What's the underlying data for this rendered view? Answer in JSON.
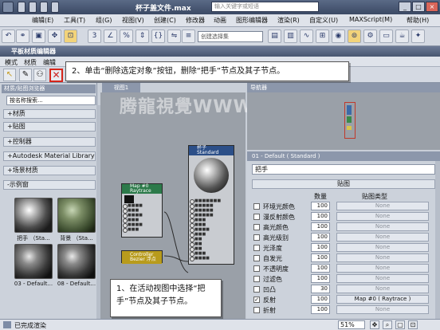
{
  "app": {
    "title": "杯子盖文件.max",
    "search_placeholder": "输入关键字或短语"
  },
  "menu": [
    "编辑(E)",
    "工具(T)",
    "组(G)",
    "视图(V)",
    "创建(C)",
    "修改器",
    "动画",
    "图形编辑器",
    "渲染(R)",
    "自定义(U)",
    "MAXScript(M)",
    "帮助(H)"
  ],
  "toolbar": {
    "selection_set": "创建选择集"
  },
  "slate": {
    "title": "平板材质编辑器",
    "menu": [
      "模式",
      "材质",
      "编辑"
    ],
    "view_tab": "视图1",
    "navigator_label": "导航器",
    "watermark": "腾龍視覺WWW.TL.NET"
  },
  "callouts": {
    "step2": "2、单击“删除选定对象”按钮，删除“把手”节点及其子节点。",
    "step1": "1、在活动视图中选择“把手”节点及其子节点。"
  },
  "browser": {
    "title": "材质/贴图浏览器",
    "search": "按名称搜索...",
    "categories": [
      "+材质",
      "+贴图",
      "+控制器",
      "+Autodesk Material Library",
      "+场景材质",
      "-示例窗"
    ],
    "samples": [
      {
        "label": "把手 （Sta..."
      },
      {
        "label": "背景 （Sta..."
      },
      {
        "label": "03 - Default..."
      },
      {
        "label": "08 - Default..."
      }
    ]
  },
  "nodes": {
    "cup_title": "杯子",
    "cup_sub": "Standard",
    "map_title": "Map #0",
    "map_sub": "Raytrace",
    "ctrl_title": "Controller",
    "ctrl_sub": "Bezier 浮点"
  },
  "params": {
    "header": "01 - Default ( Standard )",
    "material_name": "把手",
    "rollout": "贴图",
    "col_amount": "数量",
    "col_type": "贴图类型",
    "rows": [
      {
        "label": "环境光颜色",
        "amount": "100",
        "map": "None",
        "checked": false
      },
      {
        "label": "漫反射颜色",
        "amount": "100",
        "map": "None",
        "checked": false
      },
      {
        "label": "高光颜色",
        "amount": "100",
        "map": "None",
        "checked": false
      },
      {
        "label": "高光级别",
        "amount": "100",
        "map": "None",
        "checked": false
      },
      {
        "label": "光泽度",
        "amount": "100",
        "map": "None",
        "checked": false
      },
      {
        "label": "自发光",
        "amount": "100",
        "map": "None",
        "checked": false
      },
      {
        "label": "不透明度",
        "amount": "100",
        "map": "None",
        "checked": false
      },
      {
        "label": "过滤色",
        "amount": "100",
        "map": "None",
        "checked": false
      },
      {
        "label": "凹凸",
        "amount": "30",
        "map": "None",
        "checked": false
      },
      {
        "label": "反射",
        "amount": "100",
        "map": "Map #0 ( Raytrace )",
        "checked": true
      },
      {
        "label": "折射",
        "amount": "100",
        "map": "None",
        "checked": false
      }
    ]
  },
  "status": {
    "text": "已完成渲染",
    "zoom": "51%"
  }
}
